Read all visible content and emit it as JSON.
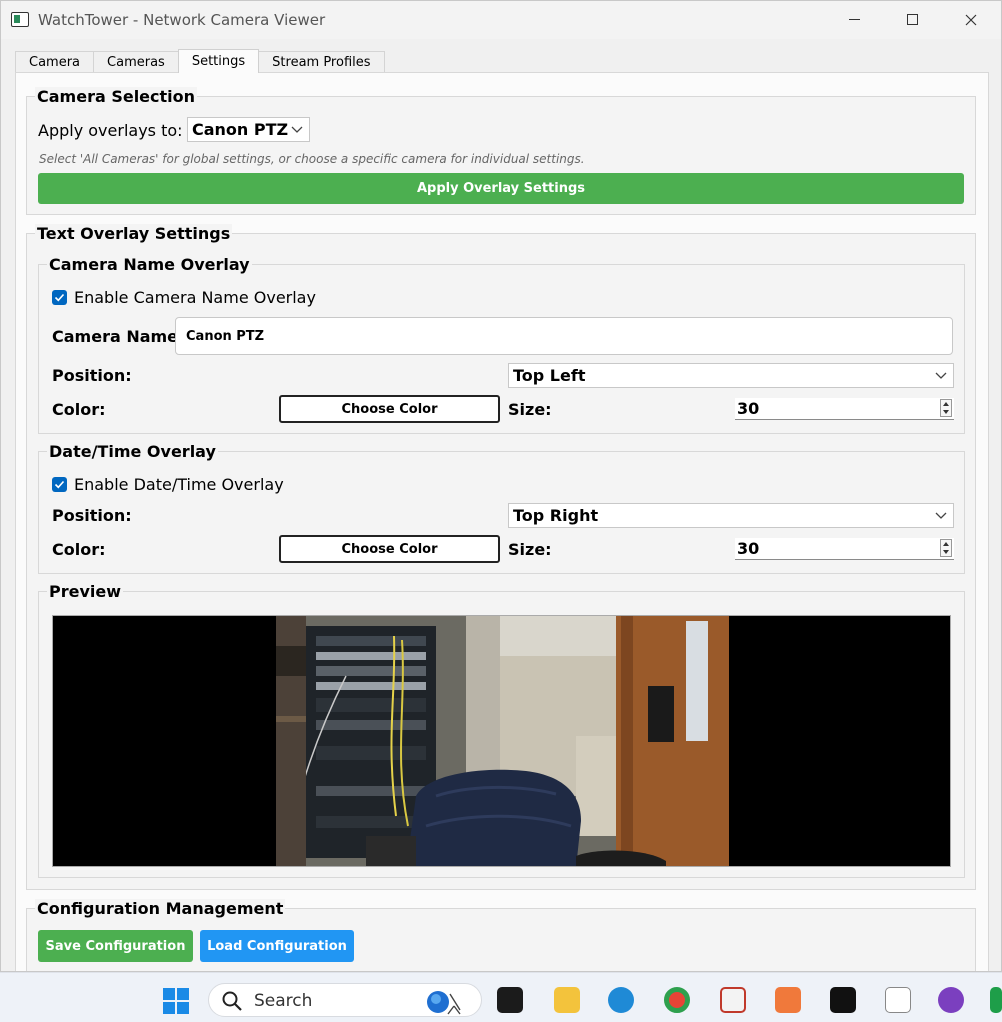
{
  "window": {
    "title": "WatchTower - Network Camera Viewer",
    "controls": {
      "minimize": "—",
      "maximize": "☐",
      "close": "✕"
    }
  },
  "tabs": [
    {
      "label": "Camera",
      "active": false
    },
    {
      "label": "Cameras",
      "active": false
    },
    {
      "label": "Settings",
      "active": true
    },
    {
      "label": "Stream Profiles",
      "active": false
    }
  ],
  "camera_selection": {
    "title": "Camera Selection",
    "apply_label": "Apply overlays to:",
    "selected_camera": "Canon PTZ",
    "hint": "Select 'All Cameras' for global settings, or choose a specific camera for individual settings.",
    "apply_button": "Apply Overlay Settings"
  },
  "text_overlay": {
    "title": "Text Overlay Settings",
    "camera_name": {
      "title": "Camera Name Overlay",
      "enable_label": "Enable Camera Name Overlay",
      "enabled": true,
      "name_label": "Camera Name:",
      "name_value": "Canon PTZ",
      "position_label": "Position:",
      "position_value": "Top Left",
      "color_label": "Color:",
      "color_button": "Choose Color",
      "size_label": "Size:",
      "size_value": "30"
    },
    "datetime": {
      "title": "Date/Time Overlay",
      "enable_label": "Enable Date/Time Overlay",
      "enabled": true,
      "position_label": "Position:",
      "position_value": "Top Right",
      "color_label": "Color:",
      "color_button": "Choose Color",
      "size_label": "Size:",
      "size_value": "30"
    },
    "preview": {
      "title": "Preview"
    }
  },
  "config": {
    "title": "Configuration Management",
    "save_button": "Save Configuration",
    "load_button": "Load Configuration"
  },
  "taskbar": {
    "search_placeholder": "Search"
  },
  "colors": {
    "green": "#4caf50",
    "blue": "#2196f3",
    "checkbox": "#0067c0"
  }
}
